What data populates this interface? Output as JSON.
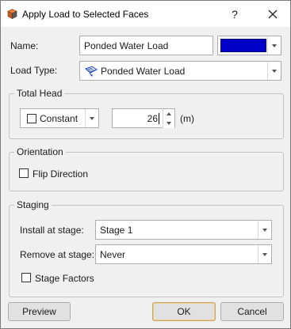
{
  "window": {
    "title": "Apply Load to Selected Faces",
    "help_glyph": "?",
    "app_icon": "box-3d-icon",
    "close_icon": "close-icon"
  },
  "name": {
    "label": "Name:",
    "value": "Ponded Water Load",
    "color_swatch": "#0000c8"
  },
  "load_type": {
    "label": "Load Type:",
    "value": "Ponded Water Load",
    "icon": "ponded-water-load-icon"
  },
  "total_head": {
    "group_title": "Total Head",
    "mode_checkbox_label": "Constant",
    "mode_checked": false,
    "value": "26",
    "unit": "(m)"
  },
  "orientation": {
    "group_title": "Orientation",
    "flip_label": "Flip Direction",
    "flip_checked": false
  },
  "staging": {
    "group_title": "Staging",
    "install_label": "Install at stage:",
    "install_value": "Stage 1",
    "remove_label": "Remove at stage:",
    "remove_value": "Never",
    "factors_label": "Stage Factors",
    "factors_checked": false
  },
  "buttons": {
    "preview": "Preview",
    "ok": "OK",
    "cancel": "Cancel"
  }
}
